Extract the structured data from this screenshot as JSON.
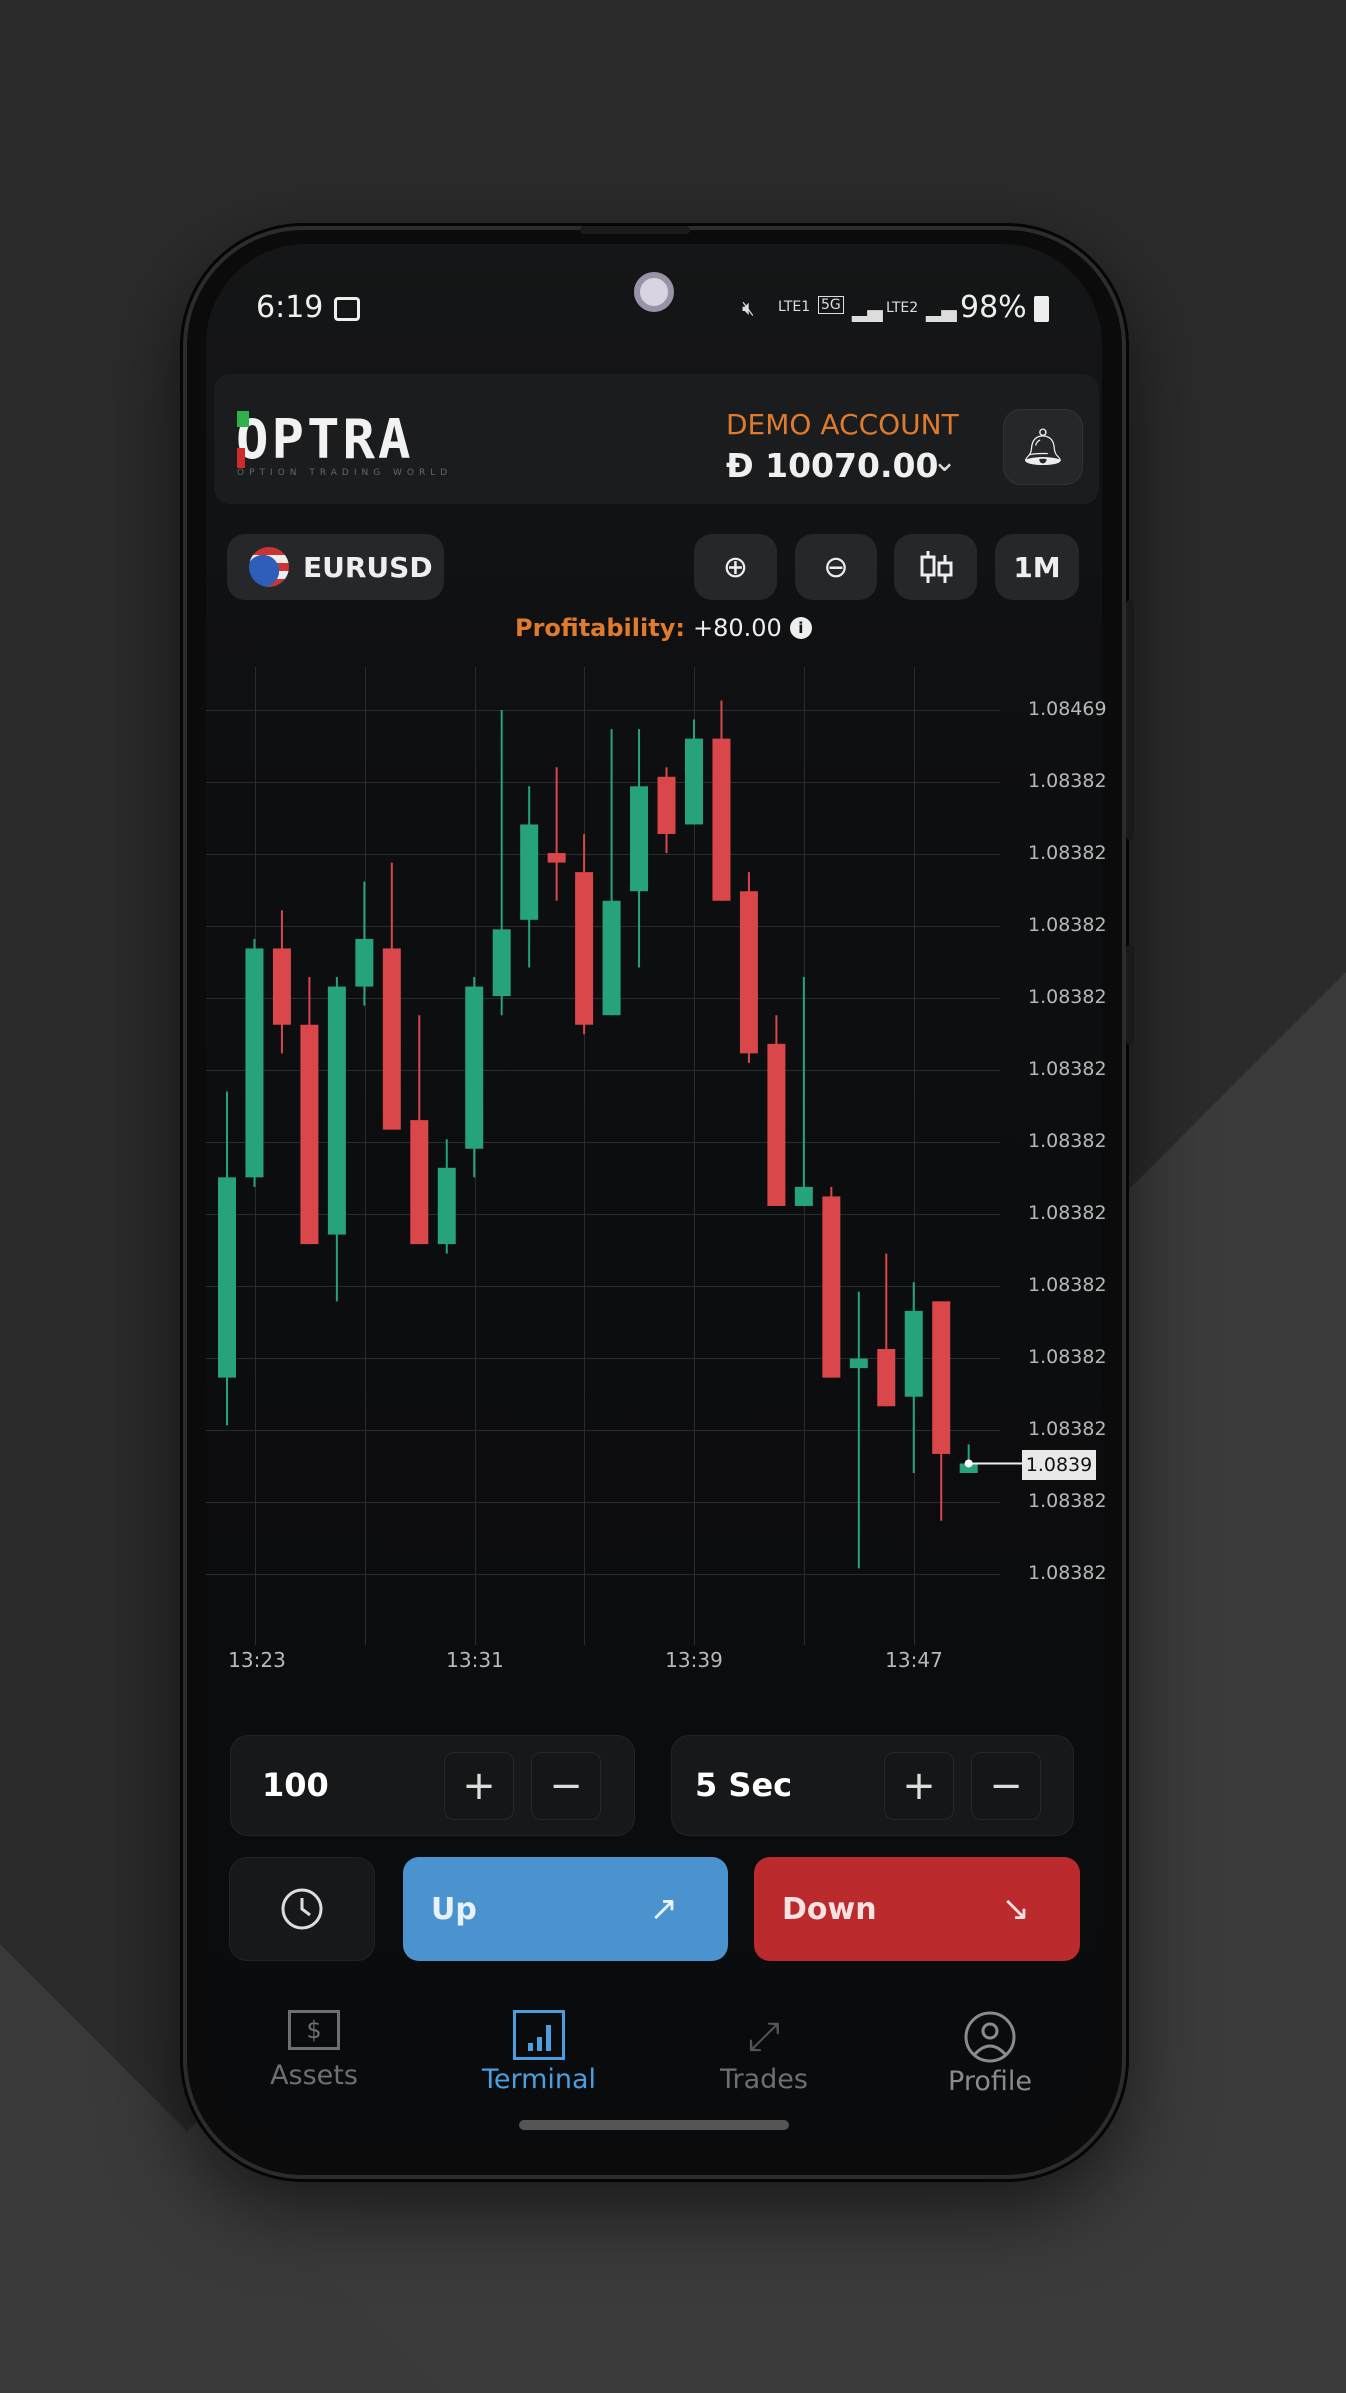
{
  "status_bar": {
    "time": "6:19",
    "battery": "98%",
    "network_1": "LTE1",
    "network_2": "LTE2",
    "network_5g": "5G"
  },
  "header": {
    "logo": "OPTRA",
    "logo_tagline": "OPTION TRADING WORLD",
    "account_type": "DEMO ACCOUNT",
    "balance": "Đ 10070.00"
  },
  "toolbar": {
    "asset": "EURUSD",
    "timeframe": "1M",
    "icons": [
      "zoom-in-icon",
      "zoom-out-icon",
      "candlestick-icon"
    ]
  },
  "profitability": {
    "label": "Profitability:",
    "value": "+80.00"
  },
  "chart_data": {
    "type": "candlestick",
    "y_tick_labels": [
      "1.08469",
      "1.08382",
      "1.08382",
      "1.08382",
      "1.08382",
      "1.08382",
      "1.08382",
      "1.08382",
      "1.08382",
      "1.08382",
      "1.08382",
      "1.08382",
      "1.08382"
    ],
    "x_tick_labels": [
      "13:23",
      "13:31",
      "13:39",
      "13:47"
    ],
    "current_price": "1.0839",
    "grid": true,
    "colors": {
      "up": "#26a37a",
      "down": "#d9474b"
    },
    "candles": [
      {
        "o": 1.08399,
        "h": 1.08429,
        "l": 1.08394,
        "c": 1.0842
      },
      {
        "o": 1.0842,
        "h": 1.08445,
        "l": 1.08419,
        "c": 1.08444
      },
      {
        "o": 1.08444,
        "h": 1.08448,
        "l": 1.08433,
        "c": 1.08436
      },
      {
        "o": 1.08436,
        "h": 1.08441,
        "l": 1.08413,
        "c": 1.08413
      },
      {
        "o": 1.08414,
        "h": 1.08441,
        "l": 1.08407,
        "c": 1.0844
      },
      {
        "o": 1.0844,
        "h": 1.08451,
        "l": 1.08438,
        "c": 1.08445
      },
      {
        "o": 1.08444,
        "h": 1.08453,
        "l": 1.08425,
        "c": 1.08425
      },
      {
        "o": 1.08426,
        "h": 1.08437,
        "l": 1.08413,
        "c": 1.08413
      },
      {
        "o": 1.08413,
        "h": 1.08424,
        "l": 1.08412,
        "c": 1.08421
      },
      {
        "o": 1.08423,
        "h": 1.08441,
        "l": 1.0842,
        "c": 1.0844
      },
      {
        "o": 1.08439,
        "h": 1.08469,
        "l": 1.08437,
        "c": 1.08446
      },
      {
        "o": 1.08447,
        "h": 1.08461,
        "l": 1.08442,
        "c": 1.08457
      },
      {
        "o": 1.08454,
        "h": 1.08463,
        "l": 1.08449,
        "c": 1.08453
      },
      {
        "o": 1.08452,
        "h": 1.08456,
        "l": 1.08435,
        "c": 1.08436
      },
      {
        "o": 1.08437,
        "h": 1.08467,
        "l": 1.08437,
        "c": 1.08449
      },
      {
        "o": 1.0845,
        "h": 1.08467,
        "l": 1.08442,
        "c": 1.08461
      },
      {
        "o": 1.08462,
        "h": 1.08463,
        "l": 1.08454,
        "c": 1.08456
      },
      {
        "o": 1.08457,
        "h": 1.08468,
        "l": 1.08457,
        "c": 1.08466
      },
      {
        "o": 1.08466,
        "h": 1.0847,
        "l": 1.08449,
        "c": 1.08449
      },
      {
        "o": 1.0845,
        "h": 1.08452,
        "l": 1.08432,
        "c": 1.08433
      },
      {
        "o": 1.08434,
        "h": 1.08437,
        "l": 1.08417,
        "c": 1.08417
      },
      {
        "o": 1.08417,
        "h": 1.08441,
        "l": 1.08417,
        "c": 1.08419
      },
      {
        "o": 1.08418,
        "h": 1.08419,
        "l": 1.08399,
        "c": 1.08399
      },
      {
        "o": 1.084,
        "h": 1.08408,
        "l": 1.08379,
        "c": 1.08401
      },
      {
        "o": 1.08402,
        "h": 1.08412,
        "l": 1.08396,
        "c": 1.08396
      },
      {
        "o": 1.08397,
        "h": 1.08409,
        "l": 1.08389,
        "c": 1.08406
      },
      {
        "o": 1.08407,
        "h": 1.08407,
        "l": 1.08384,
        "c": 1.08391
      },
      {
        "o": 1.08389,
        "h": 1.08392,
        "l": 1.08389,
        "c": 1.0839
      }
    ]
  },
  "trade": {
    "amount": "100",
    "duration": "5 Sec",
    "plus": "+",
    "minus": "−",
    "up_label": "Up",
    "down_label": "Down",
    "colors": {
      "up": "#4a93cf",
      "down": "#bb2a2c"
    }
  },
  "nav": {
    "items": [
      {
        "label": "Assets",
        "icon": "dollar-icon"
      },
      {
        "label": "Terminal",
        "icon": "chart-icon",
        "active": true
      },
      {
        "label": "Trades",
        "icon": "swap-arrows-icon"
      },
      {
        "label": "Profile",
        "icon": "user-icon"
      }
    ],
    "active_color": "#4a9fe0"
  }
}
